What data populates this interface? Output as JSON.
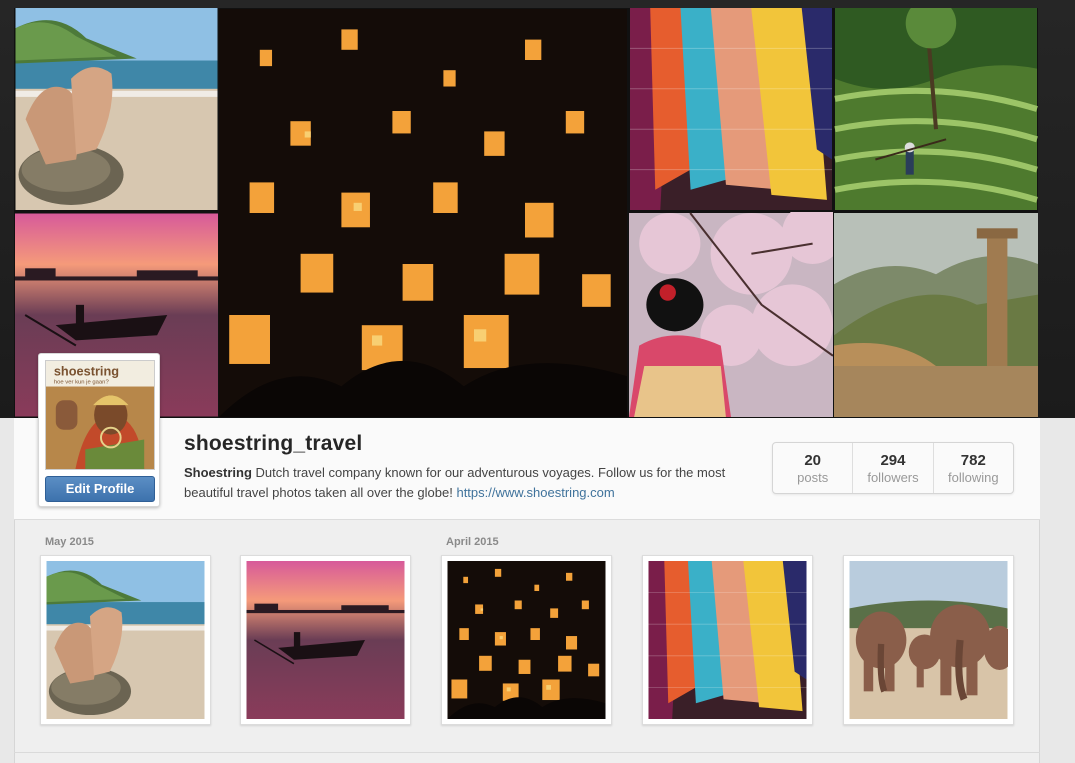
{
  "profile": {
    "username": "shoestring_travel",
    "bio_name": "Shoestring",
    "bio_text": " Dutch travel company known for our adventurous voyages. Follow us for the most beautiful travel photos taken all over the globe! ",
    "bio_link": "https://www.shoestring.com",
    "edit_button": "Edit Profile",
    "avatar_logo_text": "shoestring",
    "avatar_tagline": "hoe ver kun je gaan?"
  },
  "stats": [
    {
      "value": "20",
      "label": "posts"
    },
    {
      "value": "294",
      "label": "followers"
    },
    {
      "value": "782",
      "label": "following"
    }
  ],
  "feed": {
    "months": [
      "May 2015",
      "April 2015"
    ]
  },
  "collage": [
    {
      "name": "beach-feet-photo"
    },
    {
      "name": "sky-lanterns-photo"
    },
    {
      "name": "hammocks-photo"
    },
    {
      "name": "rice-terraces-photo"
    },
    {
      "name": "sunset-boat-photo"
    },
    {
      "name": "geisha-cherry-blossom-photo"
    },
    {
      "name": "great-wall-photo"
    }
  ],
  "thumbnails": [
    {
      "name": "beach-feet-photo"
    },
    {
      "name": "sunset-boat-photo"
    },
    {
      "name": "sky-lanterns-photo"
    },
    {
      "name": "hammocks-photo"
    },
    {
      "name": "elephants-photo"
    }
  ],
  "colors": {
    "link": "#3f729b",
    "button": "#3d72ad"
  }
}
